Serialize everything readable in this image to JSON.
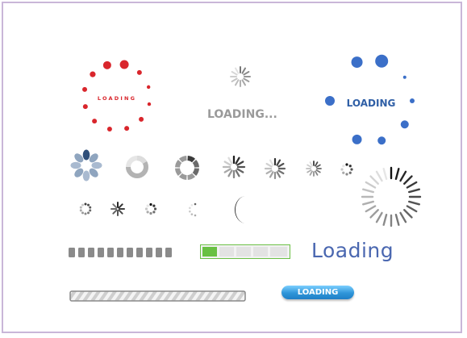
{
  "indicators": {
    "red_spinner": {
      "label": "LOADING",
      "color": "#d9262c"
    },
    "gray_text_spinner": {
      "label": "LOADING...",
      "color": "#9a9a9a"
    },
    "blue_spinner": {
      "label": "LOADING",
      "color": "#2f5fa6"
    },
    "script_loading": {
      "label": "Loading",
      "color": "#4a67b0"
    },
    "pill_button": {
      "label": "LOADING",
      "color": "#2f95d8"
    },
    "green_progress": {
      "filled_segments": 1,
      "total_segments": 5,
      "color": "#69c043"
    },
    "segmented_bar": {
      "segments": 11,
      "color": "#8a8a8a"
    },
    "striped_bar": {
      "color": "#9a9a9a"
    }
  },
  "frame": {
    "border_color": "#c9b6d8"
  }
}
